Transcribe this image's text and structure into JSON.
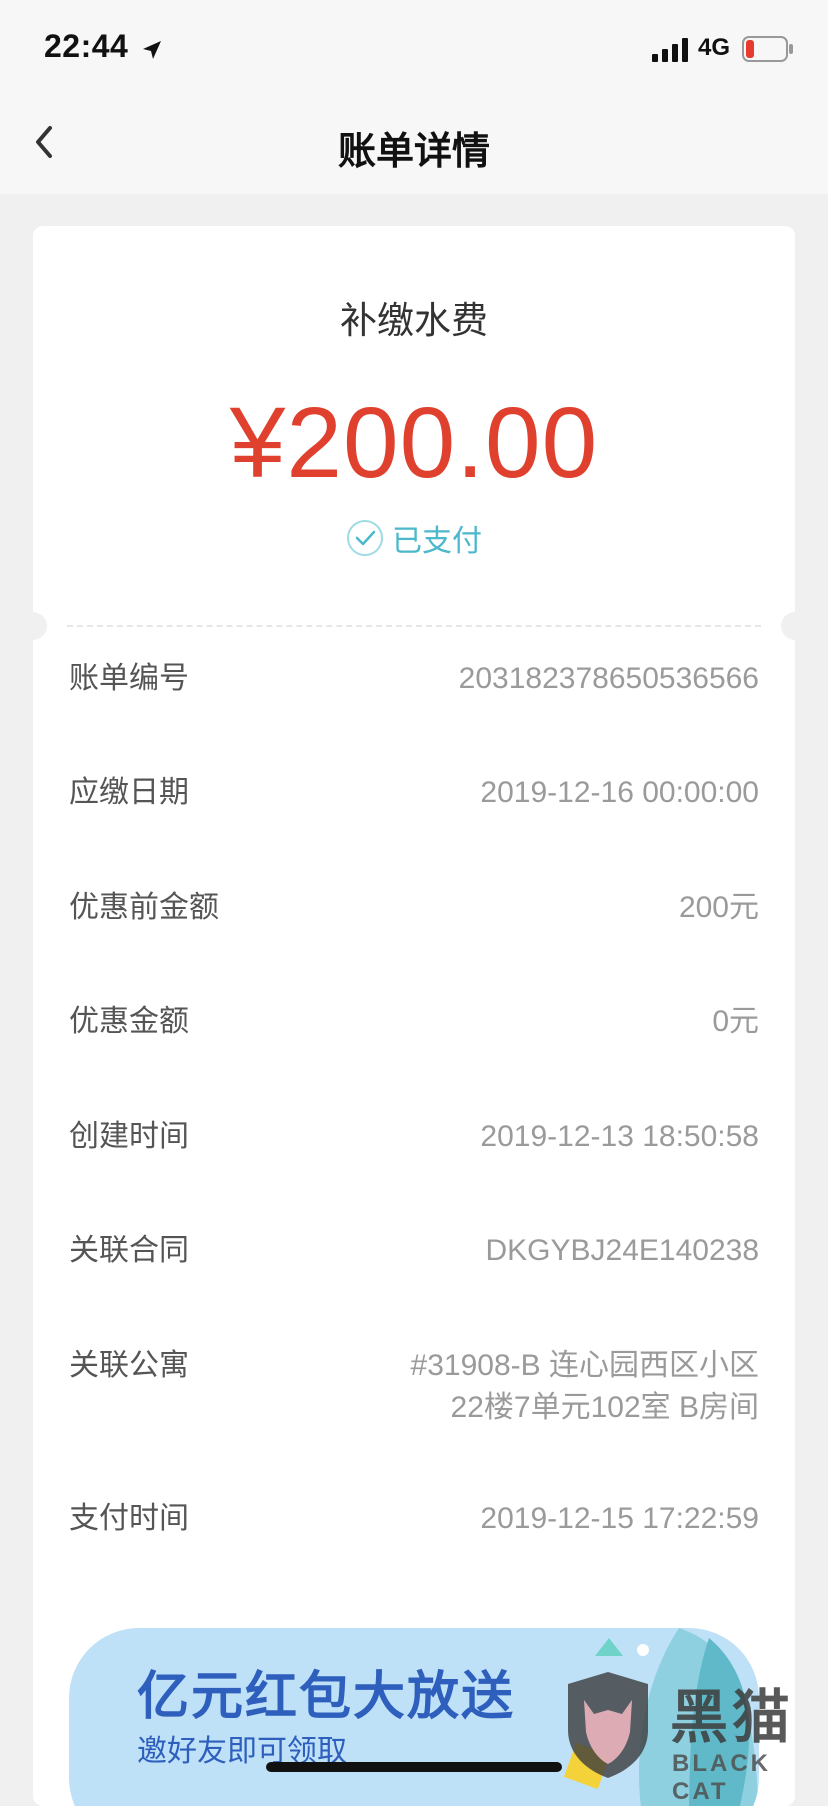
{
  "status_bar": {
    "time": "22:44",
    "network": "4G"
  },
  "nav": {
    "title": "账单详情"
  },
  "bill": {
    "title": "补缴水费",
    "amount": "¥200.00",
    "status": "已支付",
    "accent_color": "#e0412f",
    "status_color": "#4cb8cc"
  },
  "details": [
    {
      "label": "账单编号",
      "value": "203182378650536566"
    },
    {
      "label": "应缴日期",
      "value": "2019-12-16 00:00:00"
    },
    {
      "label": "优惠前金额",
      "value": "200元"
    },
    {
      "label": "优惠金额",
      "value": "0元"
    },
    {
      "label": "创建时间",
      "value": "2019-12-13 18:50:58"
    },
    {
      "label": "关联合同",
      "value": "DKGYBJ24E140238"
    },
    {
      "label": "关联公寓",
      "value": "#31908-B 连心园西区小区",
      "value_line2": "22楼7单元102室 B房间"
    },
    {
      "label": "支付时间",
      "value": "2019-12-15 17:22:59"
    }
  ],
  "banner": {
    "title": "亿元红包大放送",
    "subtitle": "邀好友即可领取"
  },
  "watermark": {
    "cn": "黑猫",
    "en": "BLACK CAT"
  }
}
